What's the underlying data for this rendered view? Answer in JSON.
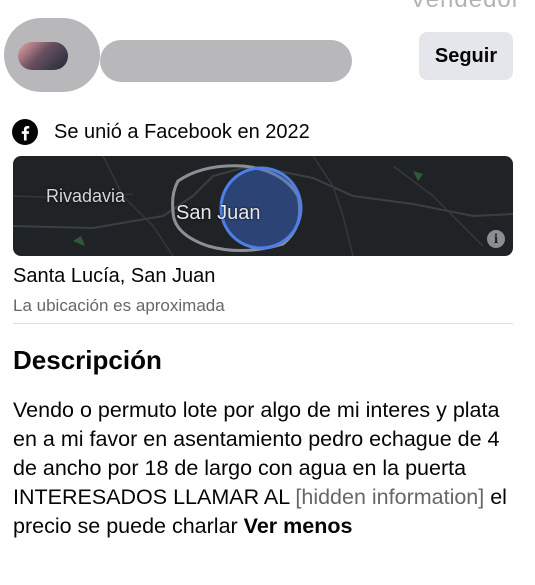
{
  "header_cutoff_text": "Vendedor",
  "seller": {
    "follow_label": "Seguir"
  },
  "joined": {
    "icon": "facebook-icon",
    "text": "Se unió a Facebook en 2022"
  },
  "map": {
    "label_left": "Rivadavia",
    "label_center": "San Juan",
    "info_icon": "i",
    "accent_color": "#3b6bd6"
  },
  "location": {
    "title": "Santa Lucía, San Juan",
    "subtitle": "La ubicación es aproximada"
  },
  "description": {
    "heading": "Descripción",
    "text_part1": "Vendo o permuto lote por algo de mi interes y plata en a mi favor en asentamiento pedro echague de 4 de ancho por 18 de largo con agua en la puerta INTERESADOS LLAMAR AL ",
    "hidden_info": "[hidden information]",
    "text_part2": " el precio se puede charlar ",
    "see_less": "Ver menos"
  }
}
